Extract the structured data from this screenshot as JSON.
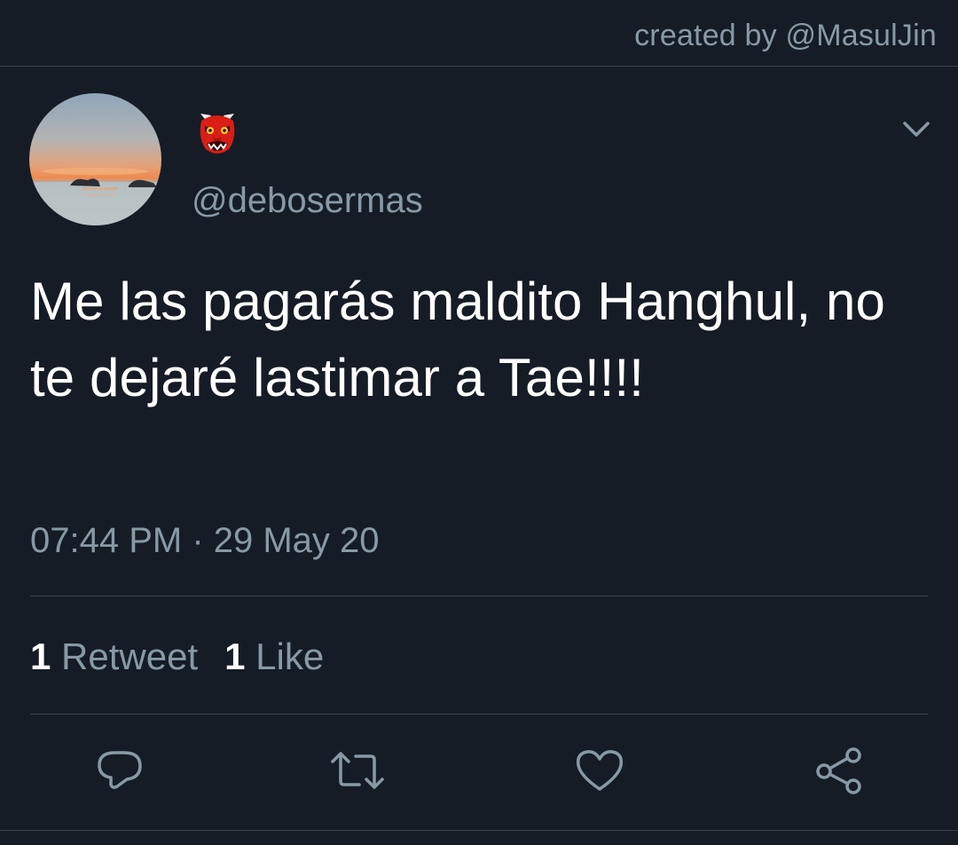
{
  "header": {
    "credit": "created by @MasulJin"
  },
  "tweet": {
    "author": {
      "display_name_icon": "red-oni-mask-emoji",
      "handle": "@debosermas",
      "avatar": "sunset-over-sea-photo"
    },
    "text": "Me las pagarás maldito Hanghul, no te dejaré lastimar a Tae!!!!",
    "timestamp": "07:44 PM · 29 May 20",
    "stats": {
      "retweet_count": "1",
      "retweet_label": "Retweet",
      "like_count": "1",
      "like_label": "Like"
    },
    "actions": [
      "reply-icon",
      "retweet-icon",
      "like-icon",
      "share-icon"
    ]
  },
  "colors": {
    "background": "#151c26",
    "secondary_text": "#8899a6",
    "divider": "#38444d",
    "primary_text": "#ffffff"
  }
}
